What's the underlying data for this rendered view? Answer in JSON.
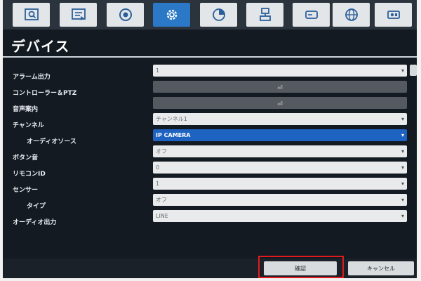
{
  "tabs": [
    {
      "name": "search-icon",
      "active": false
    },
    {
      "name": "playback-icon",
      "active": false
    },
    {
      "name": "record-icon",
      "active": false
    },
    {
      "name": "settings-gear-icon",
      "active": true
    },
    {
      "name": "stats-pie-icon",
      "active": false
    },
    {
      "name": "network-icon",
      "active": false
    },
    {
      "name": "storage-icon",
      "active": false
    },
    {
      "name": "globe-icon",
      "active": false
    },
    {
      "name": "camera-icon",
      "active": false
    }
  ],
  "page_title": "デバイス",
  "settings": [
    {
      "label": "アラーム出力",
      "value": "1",
      "type": "select"
    },
    {
      "label": "コントローラー＆PTZ",
      "value": "",
      "type": "button"
    },
    {
      "label": "音声案内",
      "value": "",
      "type": "button"
    },
    {
      "label": "チャンネル",
      "value": "チャンネル1",
      "type": "select"
    },
    {
      "label": "オーディオソース",
      "value": "IP CAMERA",
      "type": "select",
      "selected": true
    },
    {
      "label": "ボタン音",
      "value": "オフ",
      "type": "select"
    },
    {
      "label": "リモコンID",
      "value": "0",
      "type": "select"
    },
    {
      "label": "センサー",
      "value": "1",
      "type": "select"
    },
    {
      "label": "タイプ",
      "value": "オフ",
      "type": "select"
    },
    {
      "label": "オーディオ出力",
      "value": "LINE",
      "type": "select"
    }
  ],
  "footer": {
    "confirm_label": "確認",
    "cancel_label": "キャンセル"
  },
  "colors": {
    "accent": "#2b78c6",
    "selected_field": "#1f63c2",
    "highlight_box": "#e11b1b",
    "background": "#141a22"
  }
}
